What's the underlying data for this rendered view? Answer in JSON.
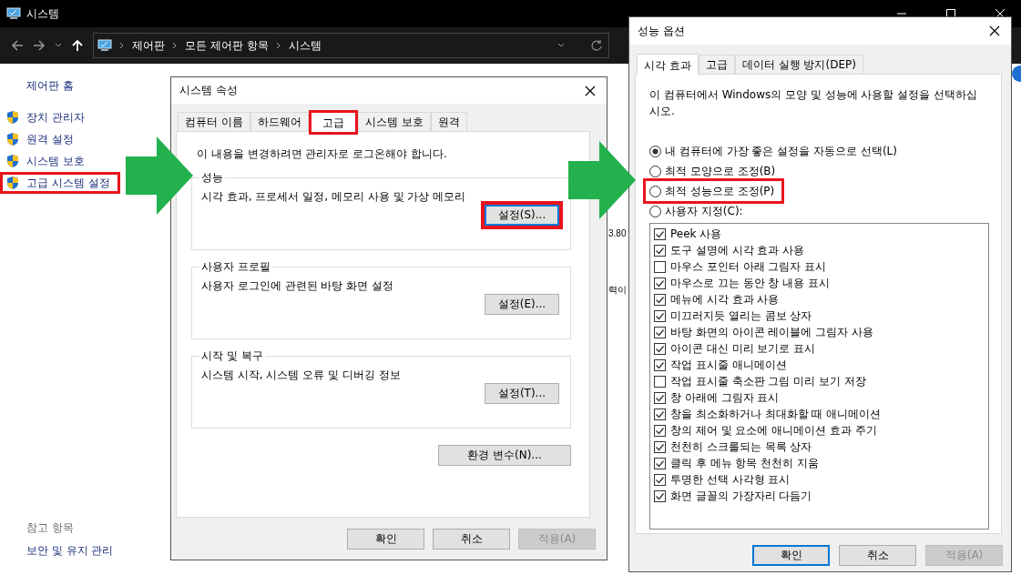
{
  "explorer": {
    "title": "시스템",
    "breadcrumb": [
      "제어판",
      "모든 제어판 항목",
      "시스템"
    ],
    "sidebar": {
      "home": "제어판 홈",
      "items": [
        {
          "label": "장치 관리자",
          "highlighted": false
        },
        {
          "label": "원격 설정",
          "highlighted": false
        },
        {
          "label": "시스템 보호",
          "highlighted": false
        },
        {
          "label": "고급 시스템 설정",
          "highlighted": true
        }
      ],
      "see_also_heading": "참고 항목",
      "see_also": [
        "보안 및 유지 관리"
      ]
    },
    "content_fragments": [
      "3.80",
      "력이"
    ]
  },
  "system_properties": {
    "title": "시스템 속성",
    "tabs": [
      {
        "label": "컴퓨터 이름",
        "selected": false,
        "highlighted": false
      },
      {
        "label": "하드웨어",
        "selected": false,
        "highlighted": false
      },
      {
        "label": "고급",
        "selected": true,
        "highlighted": true
      },
      {
        "label": "시스템 보호",
        "selected": false,
        "highlighted": false
      },
      {
        "label": "원격",
        "selected": false,
        "highlighted": false
      }
    ],
    "notice": "이 내용을 변경하려면 관리자로 로그온해야 합니다.",
    "groups": [
      {
        "title": "성능",
        "description": "시각 효과, 프로세서 일정, 메모리 사용 및 가상 메모리",
        "button": {
          "label": "설정(S)...",
          "focused": true,
          "highlighted": true
        }
      },
      {
        "title": "사용자 프로필",
        "description": "사용자 로그인에 관련된 바탕 화면 설정",
        "button": {
          "label": "설정(E)...",
          "focused": false,
          "highlighted": false
        }
      },
      {
        "title": "시작 및 복구",
        "description": "시스템 시작, 시스템 오류 및 디버깅 정보",
        "button": {
          "label": "설정(T)...",
          "focused": false,
          "highlighted": false
        }
      }
    ],
    "env_button": "환경 변수(N)...",
    "buttons": [
      {
        "label": "확인",
        "focused": false,
        "disabled": false
      },
      {
        "label": "취소",
        "focused": false,
        "disabled": false
      },
      {
        "label": "적용(A)",
        "focused": false,
        "disabled": true
      }
    ]
  },
  "performance_options": {
    "title": "성능 옵션",
    "tabs": [
      {
        "label": "시각 효과",
        "selected": true
      },
      {
        "label": "고급",
        "selected": false
      },
      {
        "label": "데이터 실행 방지(DEP)",
        "selected": false
      }
    ],
    "description": "이 컴퓨터에서 Windows의 모양 및 성능에 사용할 설정을 선택하십시오.",
    "radios": [
      {
        "label": "내 컴퓨터에 가장 좋은 설정을 자동으로 선택(L)",
        "selected": true,
        "highlighted": false
      },
      {
        "label": "최적 모양으로 조정(B)",
        "selected": false,
        "highlighted": false
      },
      {
        "label": "최적 성능으로 조정(P)",
        "selected": false,
        "highlighted": true
      },
      {
        "label": "사용자 지정(C):",
        "selected": false,
        "highlighted": false
      }
    ],
    "effects": [
      {
        "label": "Peek 사용",
        "checked": true
      },
      {
        "label": "도구 설명에 시각 효과 사용",
        "checked": true
      },
      {
        "label": "마우스 포인터 아래 그림자 표시",
        "checked": false
      },
      {
        "label": "마우스로 끄는 동안 창 내용 표시",
        "checked": true
      },
      {
        "label": "메뉴에 시각 효과 사용",
        "checked": true
      },
      {
        "label": "미끄러지듯 열리는 콤보 상자",
        "checked": true
      },
      {
        "label": "바탕 화면의 아이콘 레이블에 그림자 사용",
        "checked": true
      },
      {
        "label": "아이콘 대신 미리 보기로 표시",
        "checked": true
      },
      {
        "label": "작업 표시줄 애니메이션",
        "checked": true
      },
      {
        "label": "작업 표시줄 축소판 그림 미리 보기 저장",
        "checked": false
      },
      {
        "label": "창 아래에 그림자 표시",
        "checked": true
      },
      {
        "label": "창을 최소화하거나 최대화할 때 애니메이션",
        "checked": true
      },
      {
        "label": "창의 제어 및 요소에 애니메이션 효과 주기",
        "checked": true
      },
      {
        "label": "천천히 스크롤되는 목록 상자",
        "checked": true
      },
      {
        "label": "클릭 후 메뉴 항목 천천히 지움",
        "checked": true
      },
      {
        "label": "투명한 선택 사각형 표시",
        "checked": true
      },
      {
        "label": "화면 글꼴의 가장자리 다듬기",
        "checked": true
      }
    ],
    "buttons": [
      {
        "label": "확인",
        "focused": true,
        "disabled": false
      },
      {
        "label": "취소",
        "focused": false,
        "disabled": false
      },
      {
        "label": "적용(A)",
        "focused": false,
        "disabled": true
      }
    ]
  }
}
